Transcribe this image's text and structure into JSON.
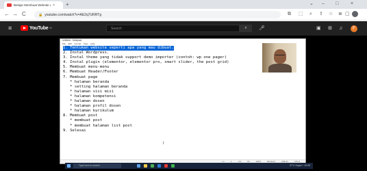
{
  "browser": {
    "tab_title": "Belajar Membuat Website d... ",
    "tab_close": "×",
    "new_tab": "+",
    "url": "youtube.com/watch?v=AE2q7URRTg",
    "nav": {
      "back": "←",
      "forward": "→",
      "reload": "C"
    },
    "window_controls": {
      "minimize": "–",
      "maximize": "□",
      "close": "×",
      "chevron": "⌄"
    }
  },
  "youtube": {
    "logo_text": "YouTube",
    "logo_sup": "ID",
    "search_placeholder": "Search",
    "avatar_letter": "F",
    "menu_icon": "≡"
  },
  "notepad": {
    "title": "Untitled - Notepad",
    "menu": "File Edit Format View Help",
    "lines": [
      "1. Tentukan website seperti apa yang mau dibuat.",
      "2. Instal Wordpress.",
      "3. Instal theme yang tidak support demo importer (contoh: wp one pager)",
      "4. Instal plugin (elementor, elementor pro, smart slider, the post grid)",
      "5. Membuat menu-menu",
      "6. Membuat Header/Footer",
      "7. Membuat page",
      "   * halaman beranda",
      "   * setting halaman beranda",
      "   * halaman visi misi",
      "   * halaman kompetensi",
      "   * halaman dosen",
      "   * halaman profil dosen",
      "   * halaman kurikulum",
      "8. Membuat post",
      "   * membuat post",
      "   * membuat halaman list post",
      "9. Selesai"
    ],
    "highlighted_line_index": 0,
    "cursor": "I",
    "status": "Ln 1, Col 50   100%   Windows (CRLF)   UTF-8"
  },
  "taskbar": {
    "search_placeholder": "Type here to search",
    "tray_text": "27°C Hujan  ^  10:05"
  },
  "colors": {
    "youtube_header": "#212121",
    "youtube_red": "#ff0000",
    "selection_blue": "#0a66d6",
    "avatar": "#e97a28"
  }
}
